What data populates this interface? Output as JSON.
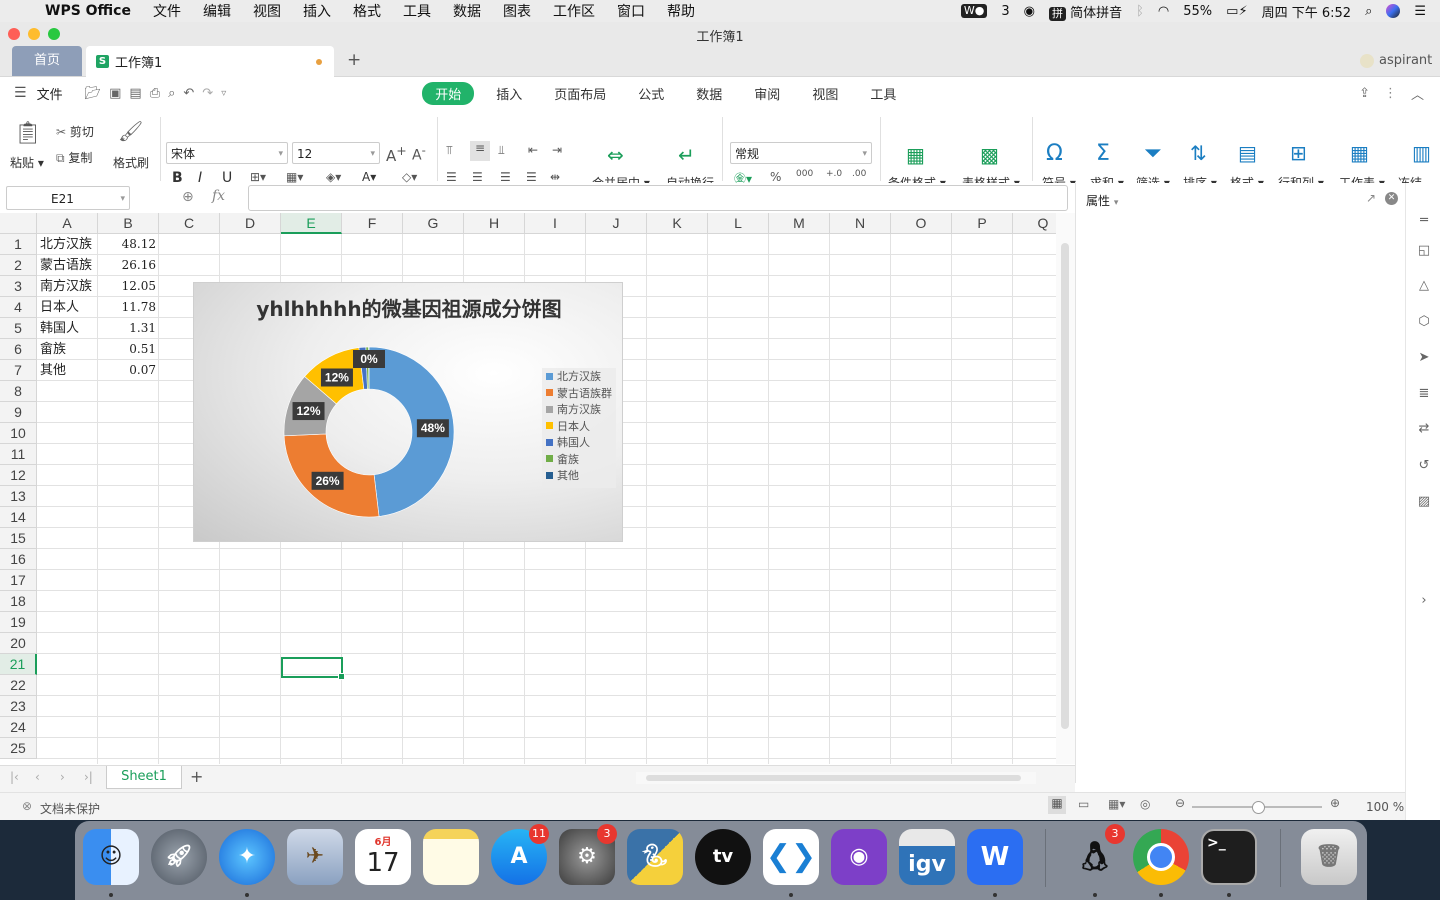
{
  "menubar": {
    "app_name": "WPS Office",
    "items": [
      "文件",
      "编辑",
      "视图",
      "插入",
      "格式",
      "工具",
      "数据",
      "图表",
      "工作区",
      "窗口",
      "帮助"
    ],
    "status": {
      "wechat_count": "3",
      "input_method": "简体拼音",
      "battery": "55%",
      "datetime": "周四 下午 6:52"
    }
  },
  "window": {
    "title": "工作簿1",
    "tabs": {
      "home": "首页",
      "doc": "工作簿1",
      "add": "+"
    },
    "user": "aspirant"
  },
  "toolbar": {
    "file_label": "文件",
    "ribbon_tabs": [
      "开始",
      "插入",
      "页面布局",
      "公式",
      "数据",
      "审阅",
      "视图",
      "工具"
    ],
    "active_tab": "开始"
  },
  "ribbon": {
    "paste": "粘贴",
    "cut": "剪切",
    "copy": "复制",
    "format_painter": "格式刷",
    "font_name": "宋体",
    "font_size": "12",
    "bold": "B",
    "italic": "I",
    "underline": "U",
    "merge_center": "合并居中",
    "wrap_text": "自动换行",
    "number_format": "常规",
    "conditional_format": "条件格式",
    "table_style": "表格样式",
    "symbol": "符号",
    "sum": "求和",
    "filter": "筛选",
    "sort": "排序",
    "format": "格式",
    "row_col": "行和列",
    "worksheet": "工作表",
    "freeze": "冻结"
  },
  "formula_bar": {
    "name_box": "E21",
    "fx": "fx",
    "value": ""
  },
  "grid": {
    "columns": [
      "A",
      "B",
      "C",
      "D",
      "E",
      "F",
      "G",
      "H",
      "I",
      "J",
      "K",
      "L",
      "M",
      "N",
      "O",
      "P",
      "Q"
    ],
    "rows": [
      "1",
      "2",
      "3",
      "4",
      "5",
      "6",
      "7",
      "8",
      "9",
      "10",
      "11",
      "12",
      "13",
      "14",
      "15",
      "16",
      "17",
      "18",
      "19",
      "20",
      "21",
      "22",
      "23",
      "24",
      "25"
    ],
    "selected_cell": "E21",
    "data": [
      {
        "label": "北方汉族",
        "value": "48.12"
      },
      {
        "label": "蒙古语族",
        "value": "26.16"
      },
      {
        "label": "南方汉族",
        "value": "12.05"
      },
      {
        "label": "日本人",
        "value": "11.78"
      },
      {
        "label": "韩国人",
        "value": "1.31"
      },
      {
        "label": "畲族",
        "value": "0.51"
      },
      {
        "label": "其他",
        "value": "0.07"
      }
    ]
  },
  "chart_data": {
    "type": "pie",
    "variant": "doughnut",
    "title": "yhlhhhhh的微基因祖源成分饼图",
    "categories": [
      "北方汉族",
      "蒙古语族群",
      "南方汉族",
      "日本人",
      "韩国人",
      "畲族",
      "其他"
    ],
    "values": [
      48.12,
      26.16,
      12.05,
      11.78,
      1.31,
      0.51,
      0.07
    ],
    "data_labels": [
      "48%",
      "26%",
      "12%",
      "12%",
      "",
      "",
      "0%"
    ],
    "colors": [
      "#5b9bd5",
      "#ed7d31",
      "#a5a5a5",
      "#ffc000",
      "#4472c4",
      "#70ad47",
      "#255e91"
    ],
    "legend_position": "right"
  },
  "right_panel": {
    "title": "属性"
  },
  "sheet_tabs": {
    "active": "Sheet1",
    "add": "+"
  },
  "status_bar": {
    "protection": "文档未保护",
    "zoom": "100 %"
  },
  "dock": {
    "apps": [
      "Finder",
      "Launchpad",
      "Safari",
      "Preview",
      "Calendar",
      "Notes",
      "App Store",
      "System Preferences",
      "Python",
      "Apple TV",
      "VS Code",
      "GitHub Desktop",
      "IGV",
      "WPS Office",
      "QQ",
      "Chrome",
      "Terminal",
      "Trash"
    ],
    "calendar_month": "6月",
    "calendar_day": "17",
    "appstore_badge": "11",
    "prefs_badge": "3",
    "qq_badge": "3",
    "igv_label": "igv",
    "tv_label": "tv"
  }
}
